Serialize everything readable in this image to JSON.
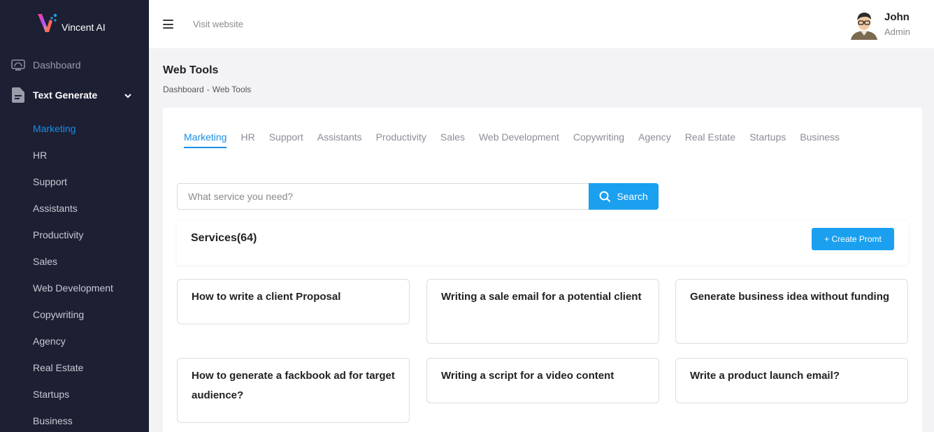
{
  "app": {
    "name": "Vincent AI"
  },
  "colors": {
    "sidebar_bg": "#1d1f33",
    "accent": "#1a8ee6",
    "button": "#1aa0ef"
  },
  "sidebar": {
    "dashboard": {
      "label": "Dashboard",
      "icon": "dashboard-icon"
    },
    "text_generate": {
      "label": "Text Generate",
      "icon": "document-icon",
      "expanded": true
    },
    "sub_items": [
      {
        "label": "Marketing"
      },
      {
        "label": "HR"
      },
      {
        "label": "Support"
      },
      {
        "label": "Assistants"
      },
      {
        "label": "Productivity"
      },
      {
        "label": "Sales"
      },
      {
        "label": "Web Development"
      },
      {
        "label": "Copywriting"
      },
      {
        "label": "Agency"
      },
      {
        "label": "Real Estate"
      },
      {
        "label": "Startups"
      },
      {
        "label": "Business"
      }
    ]
  },
  "header": {
    "visit_label": "Visit website",
    "user": {
      "name": "John",
      "role": "Admin"
    }
  },
  "page": {
    "title": "Web Tools",
    "breadcrumb": [
      "Dashboard",
      "-",
      "Web Tools"
    ]
  },
  "tabs": [
    {
      "label": "Marketing",
      "active": true
    },
    {
      "label": "HR"
    },
    {
      "label": "Support"
    },
    {
      "label": "Assistants"
    },
    {
      "label": "Productivity"
    },
    {
      "label": "Sales"
    },
    {
      "label": "Web Development"
    },
    {
      "label": "Copywriting"
    },
    {
      "label": "Agency"
    },
    {
      "label": "Real Estate"
    },
    {
      "label": "Startups"
    },
    {
      "label": "Business"
    }
  ],
  "search": {
    "placeholder": "What service you need?",
    "value": "",
    "button_label": "Search"
  },
  "services": {
    "title": "Services(64)",
    "create_label": "+ Create Promt",
    "items": [
      {
        "label": "How to write a client Proposal"
      },
      {
        "label": "Writing a sale email for a potential client"
      },
      {
        "label": "Generate business idea without funding"
      },
      {
        "label": "How to generate a fackbook ad for target audience?"
      },
      {
        "label": "Writing a script for a video content"
      },
      {
        "label": "Write a product launch email?"
      }
    ]
  }
}
